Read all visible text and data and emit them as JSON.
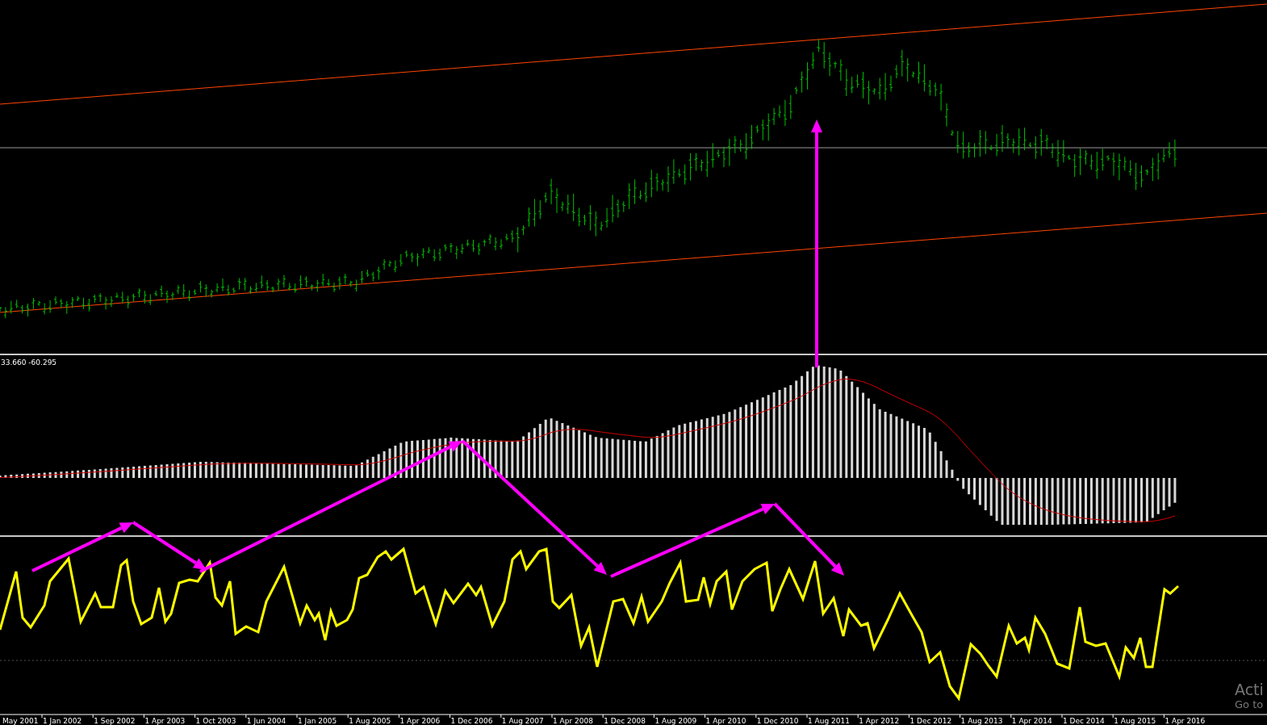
{
  "indicator_pane": {
    "label": "33.660 -60.295"
  },
  "time_axis": {
    "labels": [
      "May 2001",
      "1 Jan 2002",
      "1 Sep 2002",
      "1 Apr 2003",
      "1 Oct 2003",
      "1 Jun 2004",
      "1 Jan 2005",
      "1 Aug 2005",
      "1 Apr 2006",
      "1 Dec 2006",
      "1 Aug 2007",
      "1 Apr 2008",
      "1 Dec 2008",
      "1 Aug 2009",
      "1 Apr 2010",
      "1 Dec 2010",
      "1 Aug 2011",
      "1 Apr 2012",
      "1 Dec 2012",
      "1 Aug 2013",
      "1 Apr 2014",
      "1 Dec 2014",
      "1 Aug 2015",
      "1 Apr 2016"
    ]
  },
  "os_notice": {
    "title": "Acti",
    "subtitle": "Go to"
  }
}
